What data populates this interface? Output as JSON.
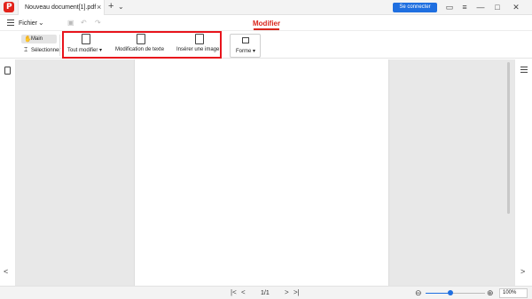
{
  "titlebar": {
    "logo_letter": "P",
    "tab_label": "Nouveau document[1].pdf",
    "tab_close_icon": "×",
    "new_tab_icon": "+",
    "tab_list_icon": "⌄",
    "connect_label": "Se connecter",
    "chat_icon": "▭",
    "menu_icon": "≡",
    "minimize_icon": "—",
    "maximize_icon": "□",
    "close_icon": "✕"
  },
  "menubar": {
    "file_label": "Fichier",
    "file_chevron": "⌄",
    "save_icon": "▣",
    "undo_icon": "↶",
    "redo_icon": "↷",
    "active_tab": "Modifier"
  },
  "ribbon": {
    "hand_label": "Main",
    "hand_icon": "✋",
    "select_label": "Sélectionner",
    "select_icon": "⌶",
    "tools": [
      {
        "label": "Tout modifier ▾"
      },
      {
        "label": "Modification de texte"
      },
      {
        "label": "Insérer une image"
      }
    ],
    "shape_label": "Forme ▾"
  },
  "statusbar": {
    "first_icon": "|<",
    "prev_icon": "<",
    "page_indicator": "1/1",
    "next_icon": ">",
    "last_icon": ">|",
    "zoom_out_icon": "⊖",
    "zoom_in_icon": "⊕",
    "zoom_level": "100%",
    "zoom_fraction": 0.42
  },
  "panels": {
    "left_arrow": "<",
    "right_arrow": ">"
  },
  "colors": {
    "accent": "#d9261c",
    "primary": "#1f6fe0",
    "highlight": "#e8141c"
  }
}
